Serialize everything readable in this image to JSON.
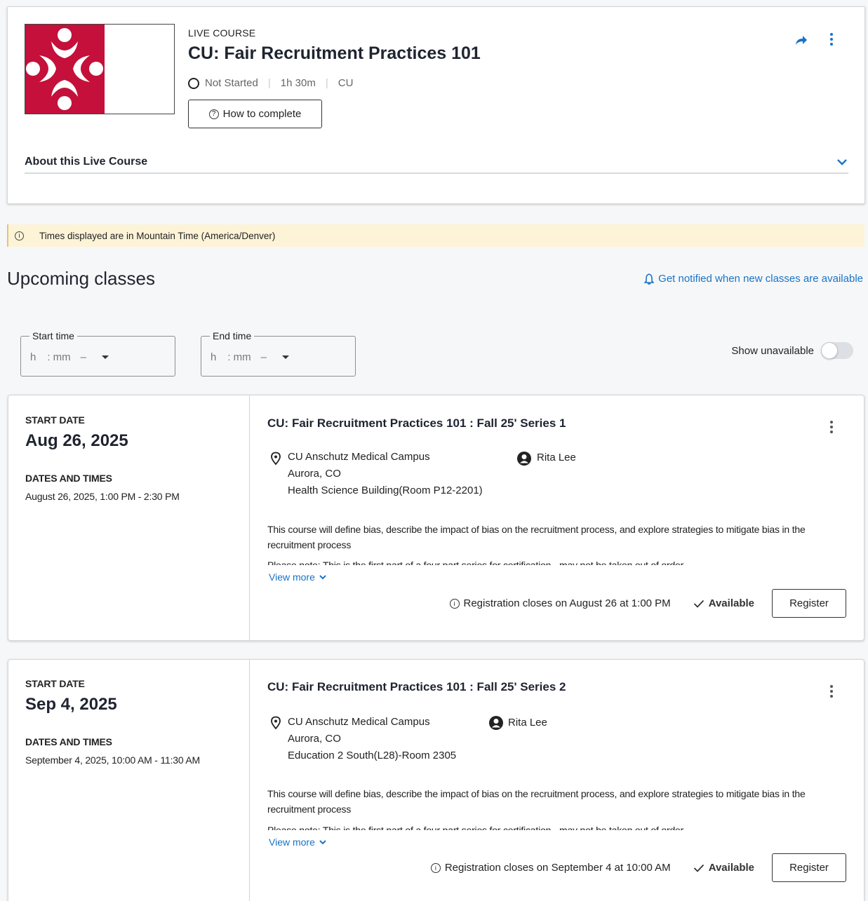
{
  "course": {
    "type_label": "LIVE COURSE",
    "title": "CU: Fair Recruitment Practices 101",
    "status": "Not Started",
    "duration": "1h 30m",
    "provider": "CU",
    "how_to_complete": "How to complete",
    "about_label": "About this Live Course",
    "logo_color": "#c4103a"
  },
  "timezone_note": "Times displayed are in Mountain Time (America/Denver)",
  "upcoming": {
    "heading": "Upcoming classes",
    "notify_link": "Get notified when new classes are available"
  },
  "filters": {
    "start_label": "Start time",
    "end_label": "End time",
    "hour_placeholder": "h",
    "minute_placeholder": ": mm",
    "ampm_placeholder": "–",
    "show_unavailable": "Show unavailable",
    "show_unavailable_on": false
  },
  "classes": [
    {
      "start_date_label": "START DATE",
      "start_date": "Aug 26, 2025",
      "dates_times_label": "DATES AND TIMES",
      "dates_times": "August 26, 2025, 1:00 PM - 2:30 PM",
      "title": "CU: Fair Recruitment Practices 101 : Fall 25' Series 1",
      "location_line1": "CU Anschutz Medical Campus",
      "location_line2": "Aurora, CO",
      "location_line3": "Health Science Building(Room P12-2201)",
      "instructor": "Rita Lee",
      "description": "This course will define bias, describe the impact of bias on the recruitment process, and explore strategies to mitigate bias in the recruitment process",
      "note": "Please note: This is the first part of a four part series for certification - may not be taken out of order",
      "view_more": "View more",
      "registration_note": "Registration closes on August 26 at 1:00 PM",
      "availability": "Available",
      "register": "Register"
    },
    {
      "start_date_label": "START DATE",
      "start_date": "Sep 4, 2025",
      "dates_times_label": "DATES AND TIMES",
      "dates_times": "September 4, 2025, 10:00 AM - 11:30 AM",
      "title": "CU: Fair Recruitment Practices 101 : Fall 25' Series 2",
      "location_line1": "CU Anschutz Medical Campus",
      "location_line2": "Aurora, CO",
      "location_line3": "Education 2 South(L28)-Room 2305",
      "instructor": "Rita Lee",
      "description": "This course will define bias, describe the impact of bias on the recruitment process, and explore strategies to mitigate bias in the recruitment process",
      "note": "Please note: This is the first part of a four part series for certification - may not be taken out of order",
      "view_more": "View more",
      "registration_note": "Registration closes on September 4 at 10:00 AM",
      "availability": "Available",
      "register": "Register"
    }
  ]
}
